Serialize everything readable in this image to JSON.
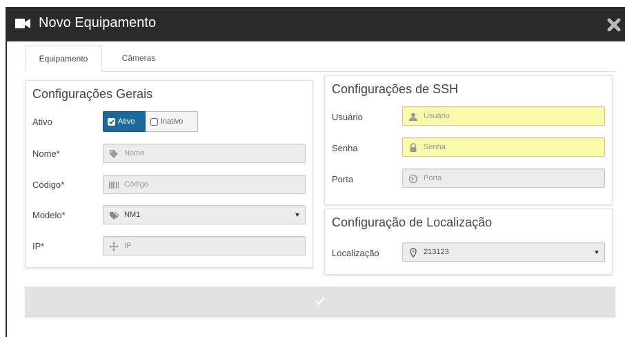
{
  "window": {
    "title": "Novo Equipamento",
    "title_icon": "video-camera-icon",
    "close_icon": "close-icon"
  },
  "tabs": [
    {
      "label": "Equipamento",
      "active": true
    },
    {
      "label": "Câmeras",
      "active": false
    }
  ],
  "general": {
    "title": "Configurações Gerais",
    "ativo": {
      "label": "Ativo",
      "on_label": "Ativo",
      "off_label": "Inativo",
      "selected": "Ativo"
    },
    "nome": {
      "label": "Nome*",
      "placeholder": "Nome",
      "icon": "tag-icon"
    },
    "codigo": {
      "label": "Código*",
      "placeholder": "Código",
      "icon": "barcode-icon"
    },
    "modelo": {
      "label": "Modelo*",
      "value": "NM1",
      "icon": "tags-icon"
    },
    "ip": {
      "label": "IP*",
      "placeholder": "IP",
      "icon": "arrows-icon"
    }
  },
  "ssh": {
    "title": "Configurações de SSH",
    "usuario": {
      "label": "Usuário",
      "placeholder": "Usuário",
      "icon": "user-icon"
    },
    "senha": {
      "label": "Senha",
      "placeholder": "Senha",
      "icon": "lock-icon"
    },
    "porta": {
      "label": "Porta",
      "placeholder": "Porta",
      "icon": "globe-icon"
    }
  },
  "location": {
    "title": "Configuração de Localização",
    "localizacao": {
      "label": "Localização",
      "value": "213123",
      "icon": "map-marker-icon"
    }
  },
  "submit": {
    "icon": "check-icon"
  },
  "colors": {
    "titlebar": "#2b2b2b",
    "toggle_active": "#1a6a9c",
    "autofill": "#fafaa8"
  }
}
